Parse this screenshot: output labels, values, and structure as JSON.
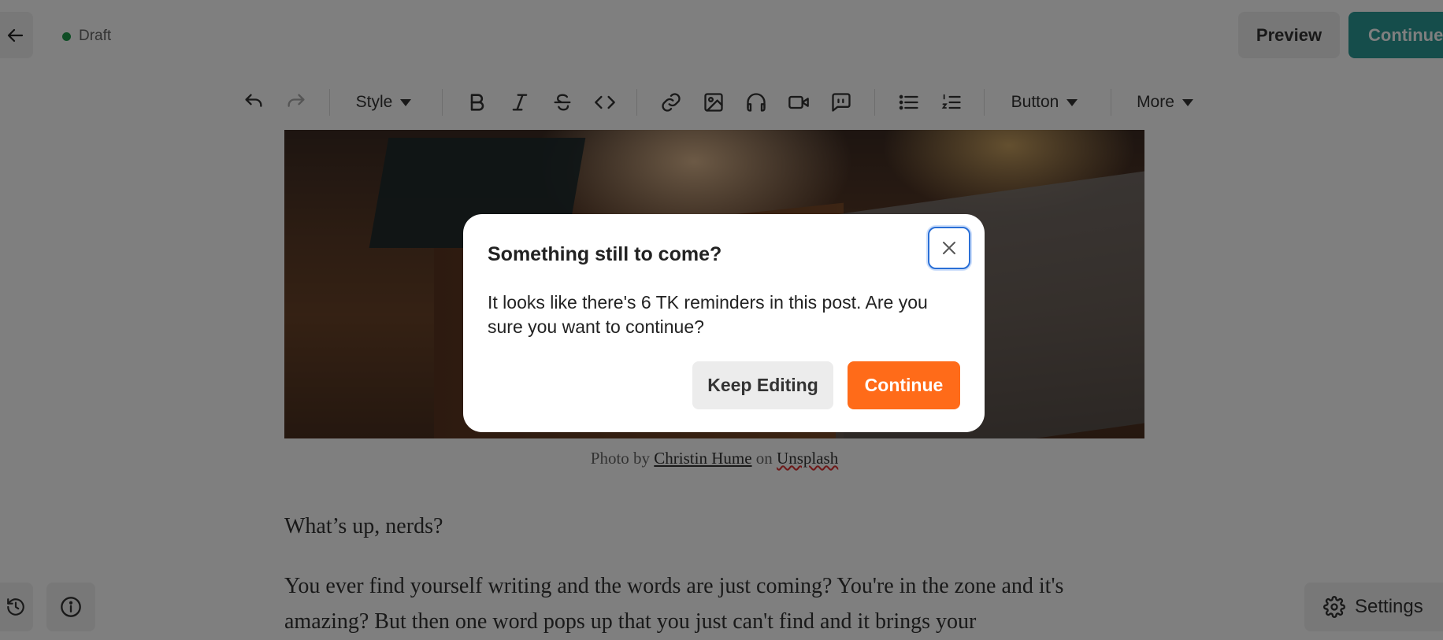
{
  "header": {
    "status": "Draft",
    "preview_label": "Preview",
    "continue_label": "Continue"
  },
  "toolbar": {
    "style_label": "Style",
    "button_label": "Button",
    "more_label": "More"
  },
  "content": {
    "caption_prefix": "Photo by",
    "caption_author": "Christin Hume",
    "caption_mid": "on",
    "caption_site": "Unsplash",
    "paragraph_1": "What’s up, nerds?",
    "paragraph_2": "You ever find yourself writing and the words are just coming? You're in the zone and it's amazing? But then one word pops up that you just can't find and it brings your"
  },
  "footer": {
    "settings_label": "Settings"
  },
  "modal": {
    "title": "Something still to come?",
    "body": "It looks like there's 6 TK reminders in this post. Are you sure you want to continue?",
    "keep_editing_label": "Keep Editing",
    "continue_label": "Continue"
  },
  "colors": {
    "accent_teal": "#2b9a96",
    "accent_orange": "#ff6b19",
    "status_green": "#1f9a4a"
  }
}
